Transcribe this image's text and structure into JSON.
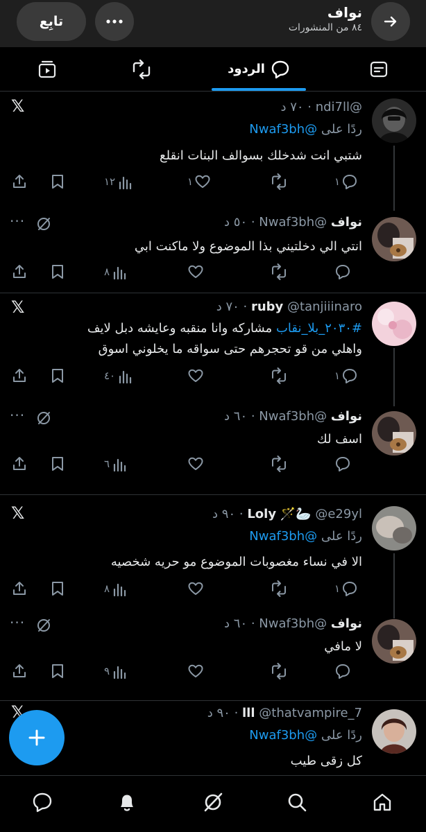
{
  "header": {
    "name": "نواف",
    "post_count": "٨٤ من المنشورات",
    "follow_label": "تابِع",
    "more_label": "•••"
  },
  "tabs": {
    "replies_label": "الردود"
  },
  "posts": [
    {
      "username": "",
      "handle": "@ndi7ll",
      "time": "٧٠ د",
      "replying_prefix": "ردًا على",
      "replying_to": "@Nwaf3bh",
      "text": "شتبي انت شدخلك بسوالف البنات انقلع",
      "replies": "١",
      "likes": "١",
      "views": "١٢"
    },
    {
      "username": "نواف",
      "handle": "@Nwaf3bh",
      "time": "٥٠ د",
      "text": "انتي الي دخلتيني بذا الموضوع ولا ماكنت ابي",
      "views": "٨"
    },
    {
      "username": "ruby",
      "handle": "@tanjiiinaro",
      "time": "٧٠ د",
      "hashtag": "#٢٠٣٠_بلا_نقاب",
      "text_line1": "مشاركه وانا منقبه وعايشه دبل لايف",
      "text_line2": "واهلي من قو تحجرهم حتى سواقه ما يخلوني اسوق",
      "replies": "١",
      "views": "٤٠"
    },
    {
      "username": "نواف",
      "handle": "@Nwaf3bh",
      "time": "٦٠ د",
      "text": "اسف لك",
      "views": "٦"
    },
    {
      "username": "Loly",
      "emoji": "🪄🦢",
      "handle": "@e29yl",
      "time": "٩٠ د",
      "replying_prefix": "ردًا على",
      "replying_to": "@Nwaf3bh",
      "text": "الا في نساء مغصوبات الموضوع مو حريه شخصيه",
      "replies": "١",
      "views": "٨"
    },
    {
      "username": "نواف",
      "handle": "@Nwaf3bh",
      "time": "٦٠ د",
      "text": "لا مافي",
      "views": "٩"
    },
    {
      "username": "lll",
      "handle": "@thatvampire_7",
      "time": "٩٠ د",
      "replying_prefix": "ردًا على",
      "replying_to": "@Nwaf3bh",
      "text": "كل زقى طيب"
    }
  ],
  "icons": {
    "back": "arrow-right-icon",
    "more": "more-dots-icon",
    "x_logo": "𝕏",
    "menu_dots": "···"
  },
  "colors": {
    "accent": "#1d9bf0",
    "background": "#000000",
    "header_bg": "#1f1f1f",
    "muted_text": "#8b98a5"
  }
}
